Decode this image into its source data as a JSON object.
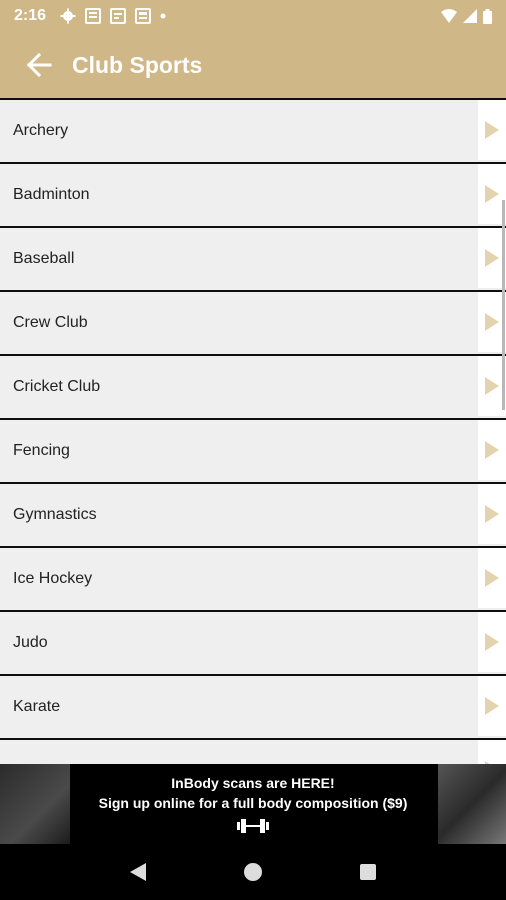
{
  "status": {
    "time": "2:16"
  },
  "appbar": {
    "title": "Club Sports"
  },
  "list": {
    "items": [
      {
        "label": "Archery"
      },
      {
        "label": "Badminton"
      },
      {
        "label": "Baseball"
      },
      {
        "label": "Crew Club"
      },
      {
        "label": "Cricket Club"
      },
      {
        "label": "Fencing"
      },
      {
        "label": "Gymnastics"
      },
      {
        "label": "Ice Hockey"
      },
      {
        "label": "Judo"
      },
      {
        "label": "Karate"
      },
      {
        "label": ""
      }
    ]
  },
  "banner": {
    "line1": "InBody scans are HERE!",
    "line2": "Sign up online for a full body composition ($9)"
  },
  "colors": {
    "brand": "#cfb787",
    "chevron": "#e3d3ae",
    "row_bg": "#efefef"
  },
  "icons": {
    "back": "arrow-left-icon",
    "chevron": "play-triangle-icon",
    "nav": [
      "back-triangle-icon",
      "home-circle-icon",
      "recents-square-icon"
    ]
  }
}
